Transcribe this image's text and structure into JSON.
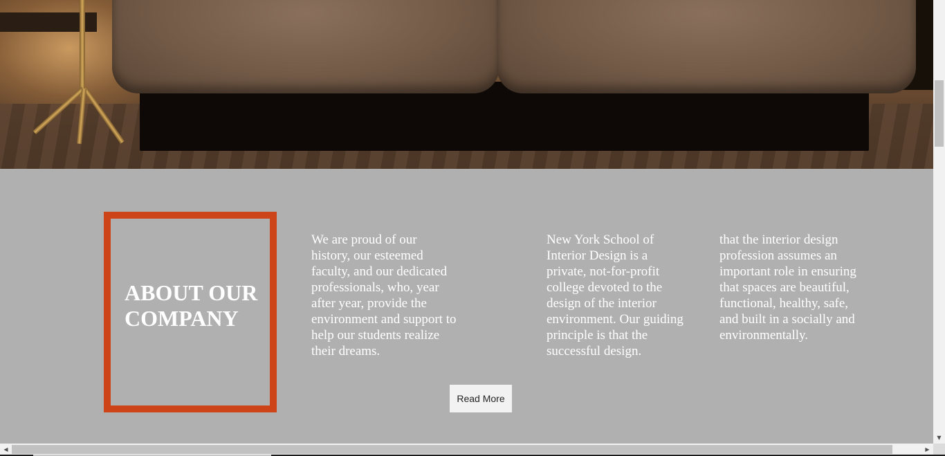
{
  "hero": {
    "image": "sofa-interior-photo"
  },
  "about": {
    "title": "ABOUT OUR COMPANY",
    "accent_color": "#cc4417",
    "columns": [
      "We are proud of our history, our esteemed faculty, and our dedicated professionals, who, year after year, provide the environment and support to help our students realize their dreams.",
      "New York School of Interior Design is a private, not-for-profit college devoted to the design of the interior environment. Our guiding principle is that the successful design.",
      "that the interior design profession assumes an important role in ensuring that spaces are beautiful, functional, healthy, safe, and built in a socially and environmentally."
    ],
    "read_more_label": "Read More"
  },
  "scrollbars": {
    "vertical_arrow_down": "▼",
    "horizontal_arrow_left": "◀",
    "horizontal_arrow_right": "▶"
  },
  "colors": {
    "section_background": "#b0b0b0",
    "text": "#ffffff",
    "button_background": "#f2f2f2"
  }
}
